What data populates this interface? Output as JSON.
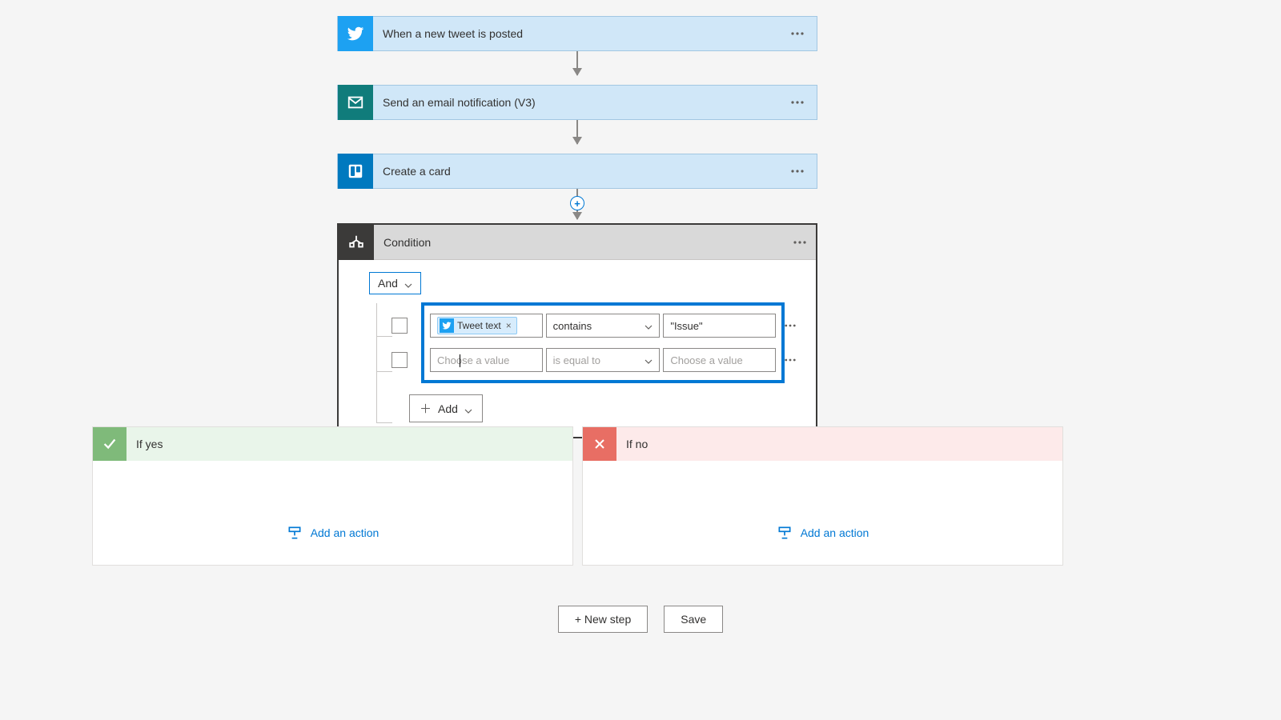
{
  "steps": [
    {
      "label": "When a new tweet is posted"
    },
    {
      "label": "Send an email notification (V3)"
    },
    {
      "label": "Create a card"
    }
  ],
  "condition": {
    "title": "Condition",
    "group_operator": "And",
    "rows": [
      {
        "left_token": "Tweet text",
        "operator": "contains",
        "right_value": "\"Issue\"",
        "left_placeholder": "Choose a value",
        "operator_placeholder": "is equal to",
        "right_placeholder": "Choose a value"
      },
      {
        "left_token": "",
        "operator": "",
        "right_value": "",
        "left_placeholder": "Choose a value",
        "operator_placeholder": "is equal to",
        "right_placeholder": "Choose a value"
      }
    ],
    "add_label": "Add"
  },
  "branches": {
    "yes": {
      "label": "If yes",
      "add_action": "Add an action"
    },
    "no": {
      "label": "If no",
      "add_action": "Add an action"
    }
  },
  "footer": {
    "new_step": "+ New step",
    "save": "Save"
  }
}
